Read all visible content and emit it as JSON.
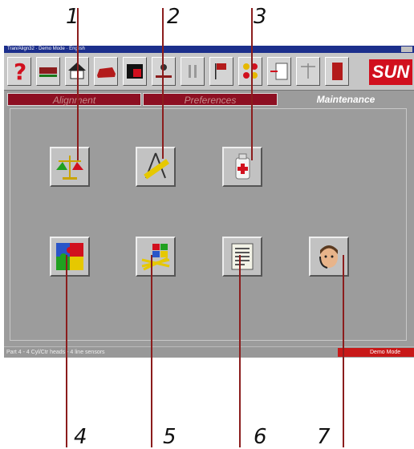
{
  "callouts": {
    "c1": "1",
    "c2": "2",
    "c3": "3",
    "c4": "4",
    "c5": "5",
    "c6": "6",
    "c7": "7"
  },
  "window": {
    "title": "Tran/Align32 · Demo Mode · English"
  },
  "toolbar": {
    "buttons": [
      "help-icon",
      "car-lift-icon",
      "home-icon",
      "sedan-icon",
      "video-icon",
      "technician-icon",
      "pause-icon",
      "flags-icon",
      "sensors-icon",
      "export-icon",
      "scale-icon",
      "exit-door-icon"
    ],
    "logo": "SUN"
  },
  "tabs": [
    {
      "label": "Alignment",
      "active": false
    },
    {
      "label": "Preferences",
      "active": false
    },
    {
      "label": "Maintenance",
      "active": true
    }
  ],
  "maintenance_icons": [
    "calibration-scale-icon",
    "compass-ruler-icon",
    "first-aid-bottle-icon",
    "puzzle-icon",
    "windows-tools-icon",
    "document-list-icon",
    "technician-headset-icon"
  ],
  "status": {
    "message": "Part 4 - 4 Cyl/Ctr heads - 4 line sensors",
    "mode": "Demo Mode"
  },
  "colors": {
    "title_bar": "#1c2f8c",
    "panel_bg": "#9c9c9c",
    "tab_inactive": "#8d0f22",
    "brand_red": "#d1101e",
    "leader": "#8b1d1d"
  }
}
